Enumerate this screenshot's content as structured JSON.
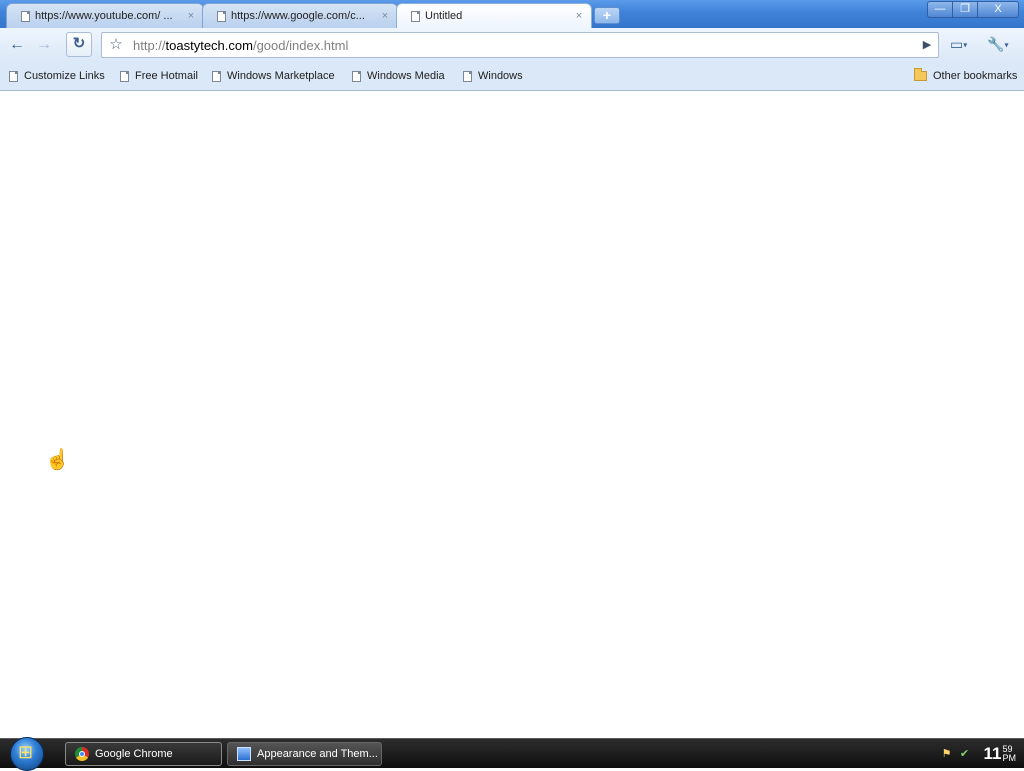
{
  "tabs": [
    {
      "title": "https://www.youtube.com/ ...",
      "active": false
    },
    {
      "title": "https://www.google.com/c...",
      "active": false
    },
    {
      "title": "Untitled",
      "active": true
    }
  ],
  "tab_close_glyph": "×",
  "new_tab_glyph": "+",
  "window_controls": {
    "minimize": "—",
    "restore": "❐",
    "close": "X"
  },
  "toolbar": {
    "back_glyph": "←",
    "forward_glyph": "→",
    "reload_glyph": "↻",
    "star_glyph": "☆",
    "go_glyph": "▶",
    "page_menu_glyph": "▭",
    "tools_menu_glyph": "🔧",
    "caret": "▾"
  },
  "omnibox": {
    "scheme": "http://",
    "host": "toastytech.com",
    "path": "/good/index.html"
  },
  "bookmarks": [
    {
      "label": "Customize Links"
    },
    {
      "label": "Free Hotmail"
    },
    {
      "label": "Windows Marketplace"
    },
    {
      "label": "Windows Media"
    },
    {
      "label": "Windows"
    }
  ],
  "other_bookmarks": "Other bookmarks",
  "cursor_glyph": "☝",
  "taskbar": {
    "items": [
      {
        "label": "Google Chrome",
        "icon": "chrome-icon",
        "active": true
      },
      {
        "label": "Appearance and Them...",
        "icon": "control-panel-icon",
        "active": false
      }
    ],
    "clock": {
      "hour": "11",
      "minute": "59",
      "ampm": "PM"
    },
    "tray_icons": [
      "network-icon",
      "safely-remove-icon"
    ]
  },
  "colors": {
    "tabstrip": "#3f82d8",
    "toolbar": "#dbe8f7",
    "taskbar": "#1a1a1a"
  }
}
